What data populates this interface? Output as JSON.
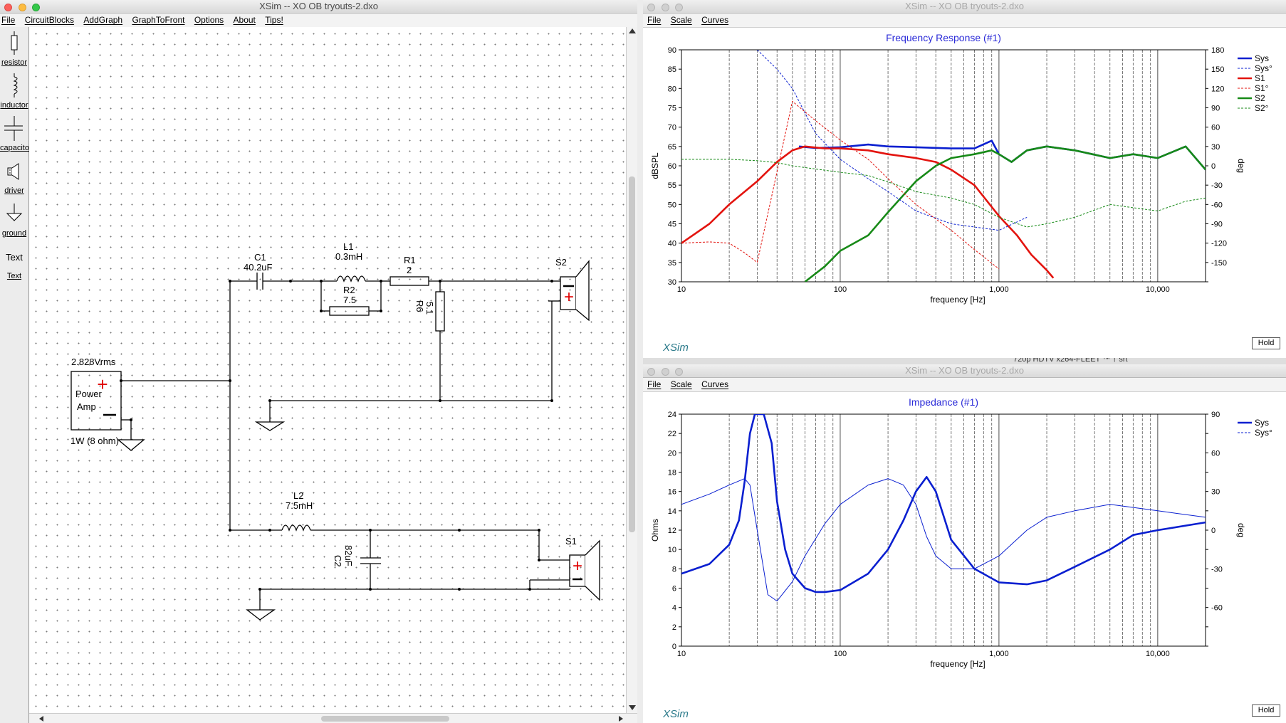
{
  "left_window": {
    "title": "XSim -- XO OB tryouts-2.dxo",
    "menu": [
      "File",
      "CircuitBlocks",
      "AddGraph",
      "GraphToFront",
      "Options",
      "About",
      "Tips!"
    ],
    "palette": [
      {
        "label": "resistor",
        "icon": "resistor-icon"
      },
      {
        "label": "inductor",
        "icon": "inductor-icon"
      },
      {
        "label": "capacitor",
        "icon": "capacitor-icon"
      },
      {
        "label": "driver",
        "icon": "driver-icon"
      },
      {
        "label": "ground",
        "icon": "ground-icon"
      },
      {
        "label": "Text",
        "icon": "text-icon",
        "glyph": "Text"
      }
    ],
    "schematic": {
      "amp_voltage": "2.828Vrms",
      "amp_name_1": "Power",
      "amp_name_2": "Amp",
      "amp_power": "1W (8 ohm)",
      "plus": "+",
      "c1_name": "C1",
      "c1_value": "40.2uF",
      "l1_name": "L1",
      "l1_value": "0.3mH",
      "r2_name": "R2",
      "r2_value": "7.5",
      "r1_name": "R1",
      "r1_value": "2",
      "r6_name": "R6",
      "r6_value": "5.1",
      "s2_name": "S2",
      "l2_name": "L2",
      "l2_value": "7.5mH",
      "c2_name": "C2",
      "c2_value": "82uF",
      "s1_name": "S1"
    }
  },
  "freq_window": {
    "title": "XSim -- XO OB tryouts-2.dxo",
    "menu": [
      "File",
      "Scale",
      "Curves"
    ],
    "graph_title": "Frequency Response (#1)",
    "ylabel": "dBSPL",
    "y2label": "deg",
    "xlabel": "frequency [Hz]",
    "y_ticks": [
      "90",
      "85",
      "80",
      "75",
      "70",
      "65",
      "60",
      "55",
      "50",
      "45",
      "40",
      "35",
      "30"
    ],
    "y2_ticks": [
      "180",
      "150",
      "120",
      "90",
      "60",
      "30",
      "0",
      "-30",
      "-60",
      "-90",
      "-120",
      "-150"
    ],
    "x_ticks": [
      "10",
      "100",
      "1,000",
      "10,000"
    ],
    "legend": [
      "Sys",
      "Sys°",
      "S1",
      "S1°",
      "S2",
      "S2°"
    ],
    "hold": "Hold",
    "logo": "XSim",
    "behind_text": "720p HDTV x264-FLEET ™ † srt"
  },
  "imp_window": {
    "title": "XSim -- XO OB tryouts-2.dxo",
    "menu": [
      "File",
      "Scale",
      "Curves"
    ],
    "graph_title": "Impedance (#1)",
    "ylabel": "Ohms",
    "y2label": "deg",
    "xlabel": "frequency [Hz]",
    "y_ticks": [
      "24",
      "22",
      "20",
      "18",
      "16",
      "14",
      "12",
      "10",
      "8",
      "6",
      "4",
      "2",
      "0"
    ],
    "y2_ticks": [
      "90",
      "60",
      "30",
      "0",
      "-30",
      "-60"
    ],
    "x_ticks": [
      "10",
      "100",
      "1,000",
      "10,000"
    ],
    "legend": [
      "Sys",
      "Sys°"
    ],
    "hold": "Hold",
    "logo": "XSim"
  },
  "colors": {
    "sys": "#0a1fd0",
    "s1": "#e3140f",
    "s2": "#178a17",
    "graph_title": "#2b2bd8",
    "grid": "#444444"
  },
  "chart_data": [
    {
      "type": "line",
      "title": "Frequency Response (#1)",
      "xlabel": "frequency [Hz]",
      "ylabel": "dBSPL",
      "y2label": "deg",
      "xscale": "log",
      "xlim": [
        10,
        20000
      ],
      "ylim": [
        30,
        90
      ],
      "y2lim": [
        -180,
        180
      ],
      "legend_position": "right",
      "grid": true,
      "series": [
        {
          "name": "Sys",
          "axis": "left",
          "x": [
            55,
            70,
            100,
            150,
            200,
            300,
            500,
            700,
            900,
            1000,
            1200,
            1500,
            2000,
            3000,
            5000,
            7000,
            10000,
            15000,
            20000
          ],
          "y": [
            65,
            64.6,
            64.8,
            65.5,
            65,
            64.8,
            64.5,
            64.5,
            66.5,
            63,
            61,
            64,
            65,
            64,
            62,
            63,
            62,
            65,
            59
          ]
        },
        {
          "name": "S1",
          "axis": "left",
          "x": [
            10,
            15,
            20,
            30,
            40,
            50,
            60,
            80,
            100,
            150,
            200,
            300,
            400,
            500,
            700,
            1000,
            1300,
            1600,
            2000,
            2200
          ],
          "y": [
            40,
            45,
            50,
            56,
            61,
            64,
            65,
            64.5,
            64.5,
            64,
            63,
            62,
            61,
            59,
            55,
            47,
            42,
            37,
            33,
            31
          ]
        },
        {
          "name": "S2",
          "axis": "left",
          "x": [
            60,
            80,
            100,
            150,
            200,
            300,
            400,
            500,
            700,
            900,
            1000,
            1200,
            1500,
            2000,
            3000,
            5000,
            7000,
            10000,
            15000,
            20000
          ],
          "y": [
            30,
            34,
            38,
            42,
            48,
            56,
            60,
            62,
            63,
            64,
            63,
            61,
            64,
            65,
            64,
            62,
            63,
            62,
            65,
            59
          ]
        },
        {
          "name": "Sys°",
          "axis": "right",
          "x": [
            30,
            40,
            50,
            70,
            100,
            150,
            200,
            300,
            500,
            700,
            1000,
            1500
          ],
          "y": [
            180,
            150,
            120,
            50,
            10,
            -20,
            -40,
            -70,
            -90,
            -95,
            -100,
            -80
          ]
        },
        {
          "name": "S1°",
          "axis": "right",
          "x": [
            10,
            15,
            20,
            25,
            30,
            50,
            70,
            100,
            150,
            200,
            300,
            500,
            700,
            1000
          ],
          "y": [
            -120,
            -118,
            -120,
            -135,
            -150,
            100,
            70,
            40,
            10,
            -20,
            -60,
            -100,
            -130,
            -160
          ]
        },
        {
          "name": "S2°",
          "axis": "right",
          "x": [
            10,
            15,
            20,
            30,
            40,
            50,
            70,
            100,
            150,
            200,
            300,
            500,
            700,
            1000,
            1500,
            2000,
            3000,
            5000,
            7000,
            10000,
            15000,
            20000
          ],
          "y": [
            10,
            10,
            10,
            8,
            5,
            0,
            -5,
            -10,
            -15,
            -25,
            -40,
            -50,
            -60,
            -80,
            -95,
            -90,
            -80,
            -60,
            -65,
            -70,
            -55,
            -50
          ]
        }
      ]
    },
    {
      "type": "line",
      "title": "Impedance (#1)",
      "xlabel": "frequency [Hz]",
      "ylabel": "Ohms",
      "y2label": "deg",
      "xscale": "log",
      "xlim": [
        10,
        20000
      ],
      "ylim": [
        0,
        24
      ],
      "y2lim": [
        -90,
        90
      ],
      "legend_position": "right",
      "grid": true,
      "series": [
        {
          "name": "Sys",
          "axis": "left",
          "x": [
            10,
            15,
            20,
            23,
            25,
            27,
            29,
            30,
            31,
            33,
            37,
            40,
            45,
            50,
            60,
            70,
            80,
            100,
            150,
            200,
            250,
            300,
            350,
            400,
            500,
            700,
            1000,
            1500,
            2000,
            3000,
            5000,
            7000,
            10000,
            20000
          ],
          "y": [
            7.5,
            8.5,
            10.5,
            13,
            17,
            22,
            24,
            24,
            24,
            24,
            21,
            15,
            10,
            7.5,
            6,
            5.6,
            5.6,
            5.8,
            7.5,
            10,
            13,
            16,
            17.5,
            16,
            11,
            8,
            6.6,
            6.4,
            6.8,
            8.2,
            10,
            11.5,
            12,
            12.8
          ]
        },
        {
          "name": "Sys°",
          "axis": "right",
          "x": [
            10,
            15,
            20,
            25,
            27,
            30,
            35,
            40,
            50,
            60,
            80,
            100,
            150,
            200,
            250,
            300,
            350,
            400,
            500,
            700,
            1000,
            1500,
            2000,
            3000,
            5000,
            10000,
            20000
          ],
          "y": [
            20,
            28,
            35,
            40,
            35,
            0,
            -50,
            -55,
            -40,
            -20,
            5,
            20,
            35,
            40,
            35,
            20,
            -5,
            -20,
            -30,
            -30,
            -20,
            0,
            10,
            15,
            20,
            15,
            10
          ]
        }
      ]
    }
  ]
}
